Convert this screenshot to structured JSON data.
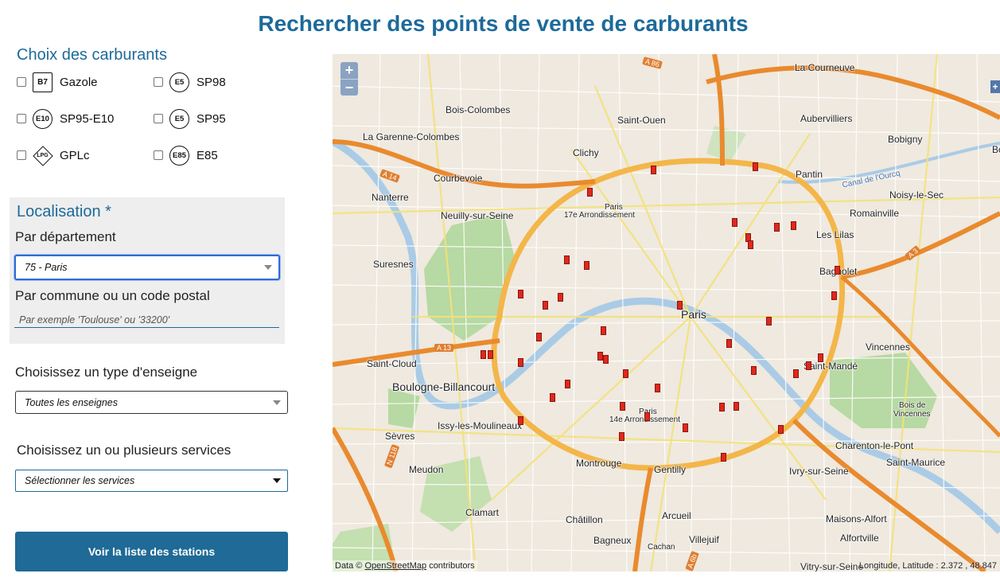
{
  "page": {
    "title": "Rechercher des points de vente de carburants"
  },
  "fuels": {
    "title": "Choix des carburants",
    "items": [
      {
        "badge": "B7",
        "label": "Gazole"
      },
      {
        "badge": "E5",
        "label": "SP98"
      },
      {
        "badge": "E10",
        "label": "SP95-E10"
      },
      {
        "badge": "E5",
        "label": "SP95"
      },
      {
        "badge": "LPG",
        "label": "GPLc"
      },
      {
        "badge": "E85",
        "label": "E85"
      }
    ]
  },
  "localisation": {
    "title": "Localisation *",
    "department_label": "Par département",
    "department_value": "75 - Paris",
    "commune_label": "Par commune ou un code postal",
    "commune_placeholder": "Par exemple 'Toulouse' ou '33200'"
  },
  "enseigne": {
    "label": "Choisissez un type d'enseigne",
    "value": "Toutes les enseignes"
  },
  "services": {
    "label": "Choisissez un ou plusieurs services",
    "value": "Sélectionner les services"
  },
  "submit": {
    "label": "Voir la liste des stations"
  },
  "map": {
    "zoom_in": "+",
    "zoom_out": "−",
    "layer_switch": "+",
    "places": [
      "La Courneuve",
      "Bois-Colombes",
      "Saint-Ouen",
      "Aubervilliers",
      "La Garenne-Colombes",
      "Bobigny",
      "Clichy",
      "Courbevoie",
      "Pantin",
      "Noisy-le-Sec",
      "Nanterre",
      "Paris",
      "17e Arrondissement",
      "Neuilly-sur-Seine",
      "Romainville",
      "Les Lilas",
      "Suresnes",
      "Bagnolet",
      "Paris",
      "Vincennes",
      "Saint-Cloud",
      "Saint-Mandé",
      "Boulogne-Billancourt",
      "Paris",
      "14e Arrondissement",
      "Bois de",
      "Vincennes",
      "Issy-les-Moulineaux",
      "Sèvres",
      "Charenton-le-Pont",
      "Saint-Maurice",
      "Meudon",
      "Montrouge",
      "Gentilly",
      "Ivry-sur-Seine",
      "Clamart",
      "Arcueil",
      "Maisons-Alfort",
      "Châtillon",
      "Villejuif",
      "Bagneux",
      "Cachan",
      "Alfortville",
      "Vitry-sur-Seine",
      "Bo"
    ],
    "road_labels": [
      "A 86",
      "A 14",
      "A 13",
      "N 118",
      "A 3",
      "A 6b"
    ],
    "canal_label": "Canal de l'Ourcq",
    "attribution_prefix": "Data ©",
    "attribution_link": "OpenStreetMap",
    "attribution_suffix": "contributors",
    "coordinates": "Longitude, Latitude : 2.372 , 48.847"
  },
  "colors": {
    "accent": "#1d6a9a",
    "button": "#1f6a96",
    "station_marker": "#e0281c",
    "motorway": "#e98a2e",
    "primary_road": "#f5c542"
  }
}
